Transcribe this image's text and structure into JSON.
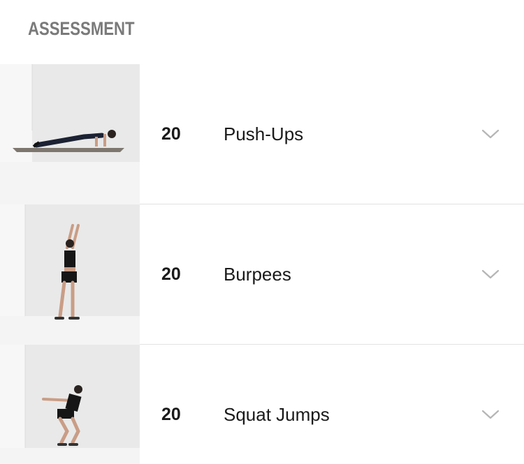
{
  "header": {
    "title": "ASSESSMENT"
  },
  "exercises": [
    {
      "reps": "20",
      "name": "Push-Ups",
      "thumbnail": "push-up-figure",
      "expand_icon": "chevron-down-icon"
    },
    {
      "reps": "20",
      "name": "Burpees",
      "thumbnail": "burpee-jump-figure",
      "expand_icon": "chevron-down-icon"
    },
    {
      "reps": "20",
      "name": "Squat Jumps",
      "thumbnail": "squat-figure",
      "expand_icon": "chevron-down-icon"
    }
  ],
  "colors": {
    "title": "#7a7a7a",
    "divider": "#e2e2e2",
    "chevron": "#b5b5b5",
    "text": "#1a1a1a"
  }
}
